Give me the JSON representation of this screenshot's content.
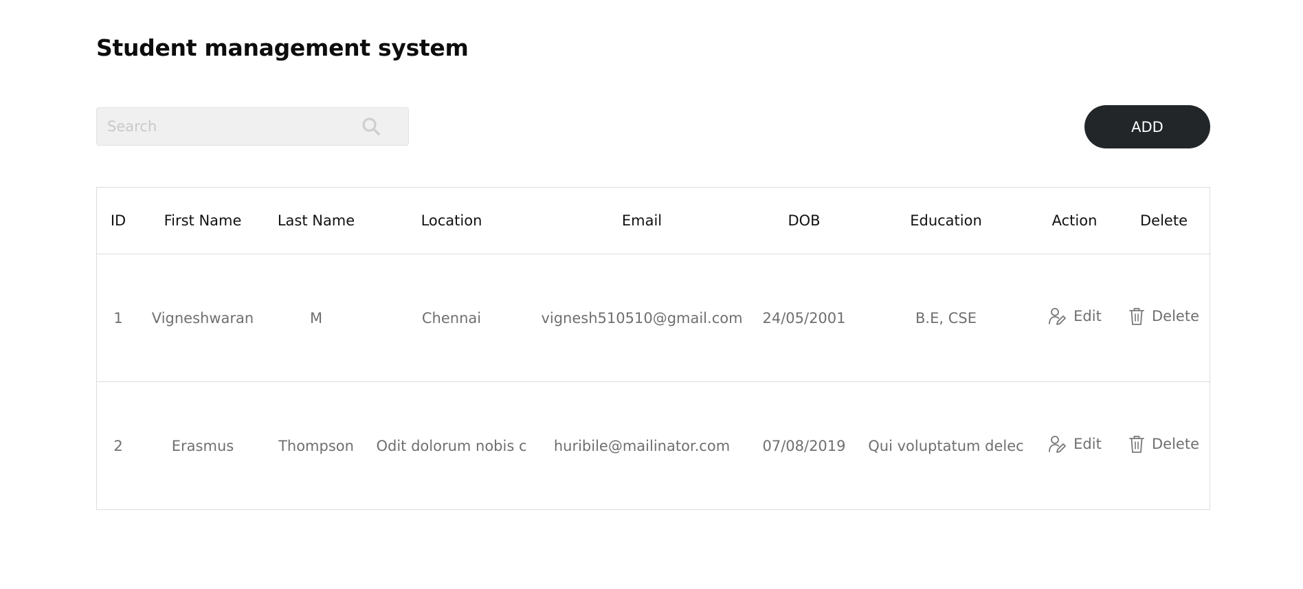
{
  "page": {
    "title": "Student management system"
  },
  "search": {
    "placeholder": "Search",
    "icon": "search-icon"
  },
  "toolbar": {
    "add_label": "ADD"
  },
  "table": {
    "columns": [
      "ID",
      "First Name",
      "Last Name",
      "Location",
      "Email",
      "DOB",
      "Education",
      "Action",
      "Delete"
    ],
    "rows": [
      {
        "id": "1",
        "first_name": "Vigneshwaran",
        "last_name": "M",
        "location": "Chennai",
        "email": "vignesh510510@gmail.com",
        "dob": "24/05/2001",
        "education": "B.E, CSE",
        "edit_label": "Edit",
        "delete_label": "Delete"
      },
      {
        "id": "2",
        "first_name": "Erasmus",
        "last_name": "Thompson",
        "location": "Odit dolorum nobis c",
        "email": "huribile@mailinator.com",
        "dob": "07/08/2019",
        "education": "Qui voluptatum delec",
        "edit_label": "Edit",
        "delete_label": "Delete"
      }
    ]
  },
  "colors": {
    "primary_button": "#222629",
    "muted_text": "#6f6f6f",
    "border": "#dcdcdc",
    "search_bg": "#f0f0f0"
  }
}
